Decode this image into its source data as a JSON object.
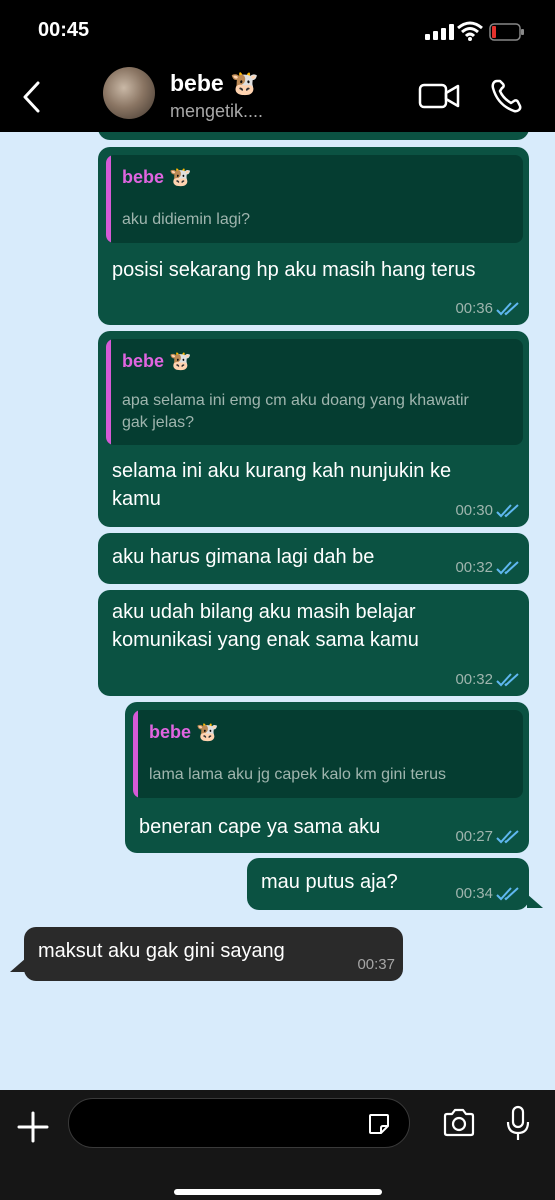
{
  "status_bar": {
    "time": "00:45"
  },
  "header": {
    "contact_name": "bebe 🐮",
    "status": "mengetik...."
  },
  "messages": [
    {
      "reply_to": {
        "name": "bebe 🐮",
        "text": "aku didiemin lagi?"
      },
      "text": "posisi sekarang hp aku masih hang terus",
      "time": "00:36",
      "direction": "out"
    },
    {
      "reply_to": {
        "name": "bebe 🐮",
        "text": "apa selama ini emg cm aku doang yang khawatir gak jelas?"
      },
      "text": "selama ini aku kurang kah nunjukin ke kamu",
      "time": "00:30",
      "direction": "out"
    },
    {
      "text": "aku harus gimana lagi dah be",
      "time": "00:32",
      "direction": "out"
    },
    {
      "text": "aku udah bilang aku masih belajar komunikasi yang enak sama kamu",
      "time": "00:32",
      "direction": "out"
    },
    {
      "reply_to": {
        "name": "bebe 🐮",
        "text": "lama lama aku jg capek kalo km gini terus"
      },
      "text": "beneran cape ya sama aku",
      "time": "00:27",
      "direction": "out"
    },
    {
      "text": "mau putus aja?",
      "time": "00:34",
      "direction": "out"
    },
    {
      "text": "maksut aku gak gini sayang",
      "time": "00:37",
      "direction": "in"
    }
  ],
  "colors": {
    "outgoing_bubble": "#0b5242",
    "incoming_bubble": "#2a2a2a",
    "quote_name": "#e065e0",
    "read_ticks": "#5fb7f0",
    "chat_background": "#d8ebfb"
  },
  "icons": [
    "back-chevron-icon",
    "video-call-icon",
    "phone-icon",
    "plus-icon",
    "sticker-icon",
    "camera-icon",
    "microphone-icon",
    "read-receipt-icon"
  ]
}
